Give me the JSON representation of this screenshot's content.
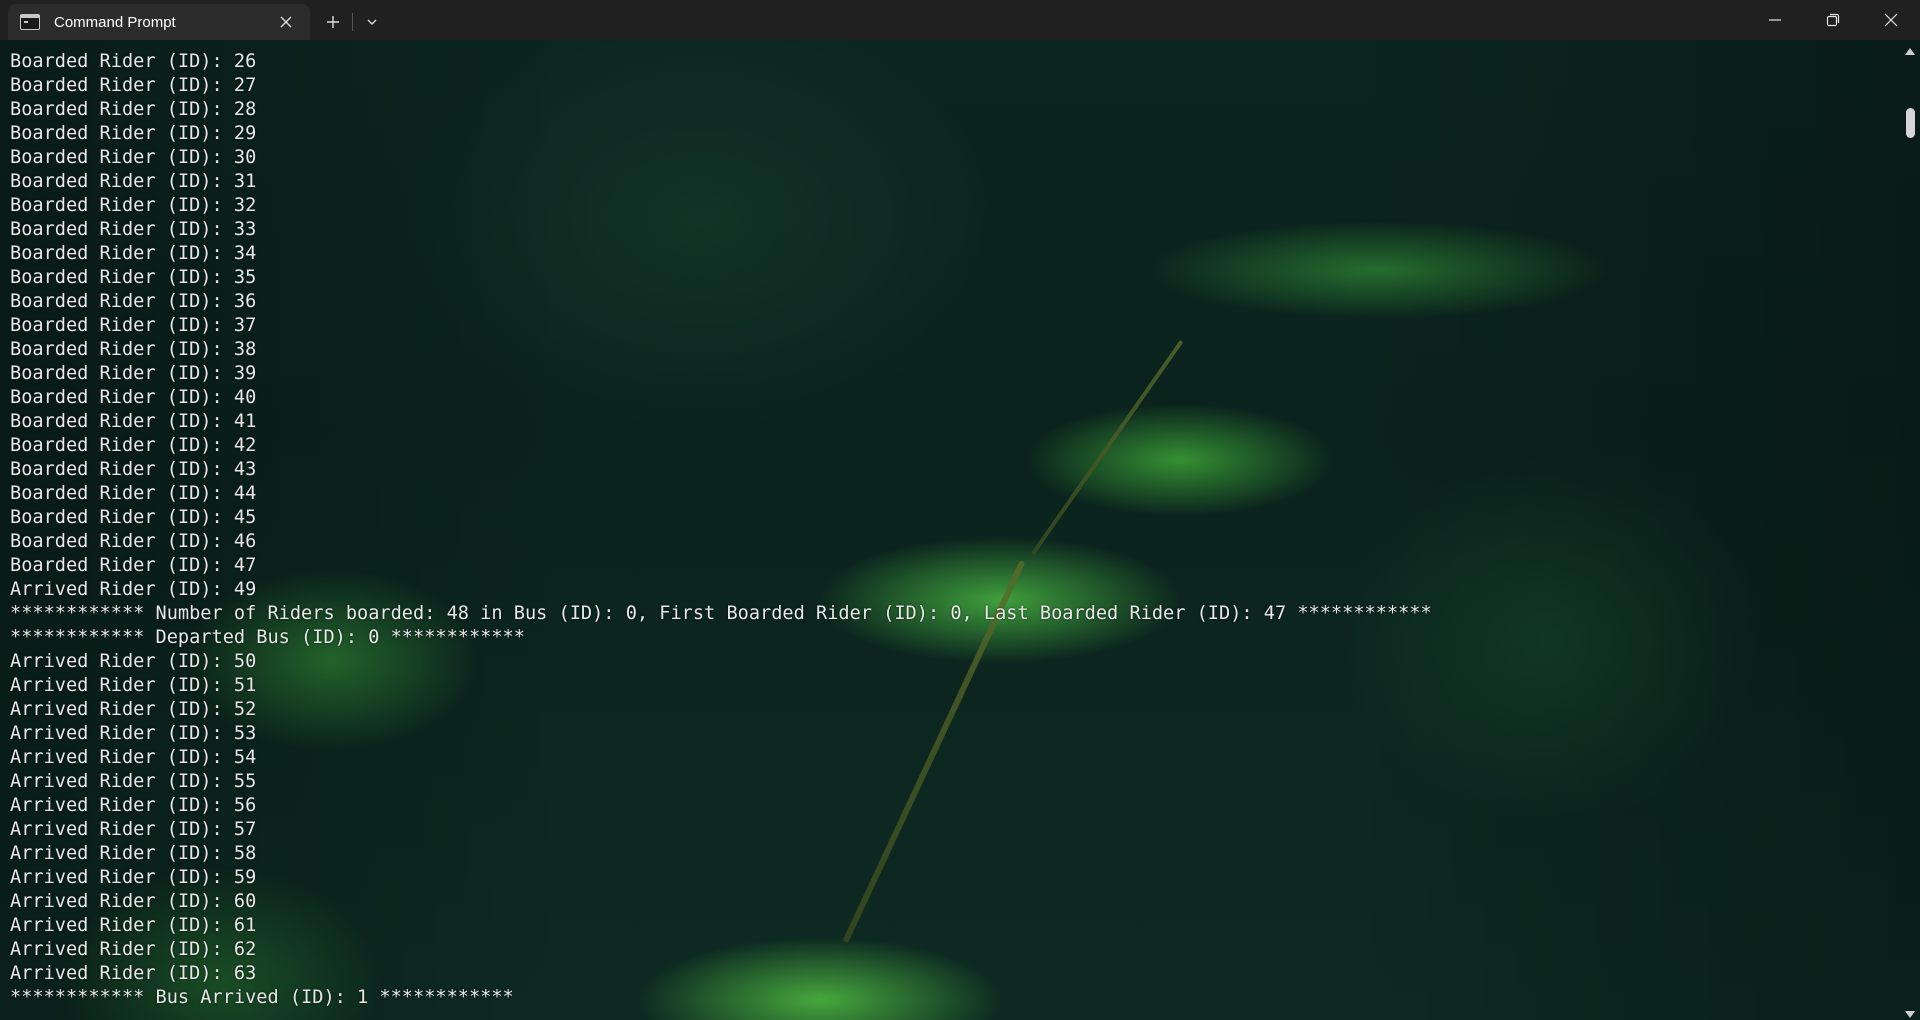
{
  "window": {
    "tab_title": "Command Prompt",
    "icons": {
      "tab": "terminal-icon",
      "close_tab": "close-icon",
      "new_tab": "plus-icon",
      "dropdown": "chevron-down-icon",
      "minimize": "minimize-icon",
      "maximize": "restore-icon",
      "close_window": "close-icon"
    }
  },
  "terminal": {
    "lines": [
      "Boarded Rider (ID): 26",
      "Boarded Rider (ID): 27",
      "Boarded Rider (ID): 28",
      "Boarded Rider (ID): 29",
      "Boarded Rider (ID): 30",
      "Boarded Rider (ID): 31",
      "Boarded Rider (ID): 32",
      "Boarded Rider (ID): 33",
      "Boarded Rider (ID): 34",
      "Boarded Rider (ID): 35",
      "Boarded Rider (ID): 36",
      "Boarded Rider (ID): 37",
      "Boarded Rider (ID): 38",
      "Boarded Rider (ID): 39",
      "Boarded Rider (ID): 40",
      "Boarded Rider (ID): 41",
      "Boarded Rider (ID): 42",
      "Boarded Rider (ID): 43",
      "Boarded Rider (ID): 44",
      "Boarded Rider (ID): 45",
      "Boarded Rider (ID): 46",
      "Boarded Rider (ID): 47",
      "Arrived Rider (ID): 49",
      "************ Number of Riders boarded: 48 in Bus (ID): 0, First Boarded Rider (ID): 0, Last Boarded Rider (ID): 47 ************",
      "************ Departed Bus (ID): 0 ************",
      "Arrived Rider (ID): 50",
      "Arrived Rider (ID): 51",
      "Arrived Rider (ID): 52",
      "Arrived Rider (ID): 53",
      "Arrived Rider (ID): 54",
      "Arrived Rider (ID): 55",
      "Arrived Rider (ID): 56",
      "Arrived Rider (ID): 57",
      "Arrived Rider (ID): 58",
      "Arrived Rider (ID): 59",
      "Arrived Rider (ID): 60",
      "Arrived Rider (ID): 61",
      "Arrived Rider (ID): 62",
      "Arrived Rider (ID): 63",
      "************ Bus Arrived (ID): 1 ************"
    ]
  }
}
